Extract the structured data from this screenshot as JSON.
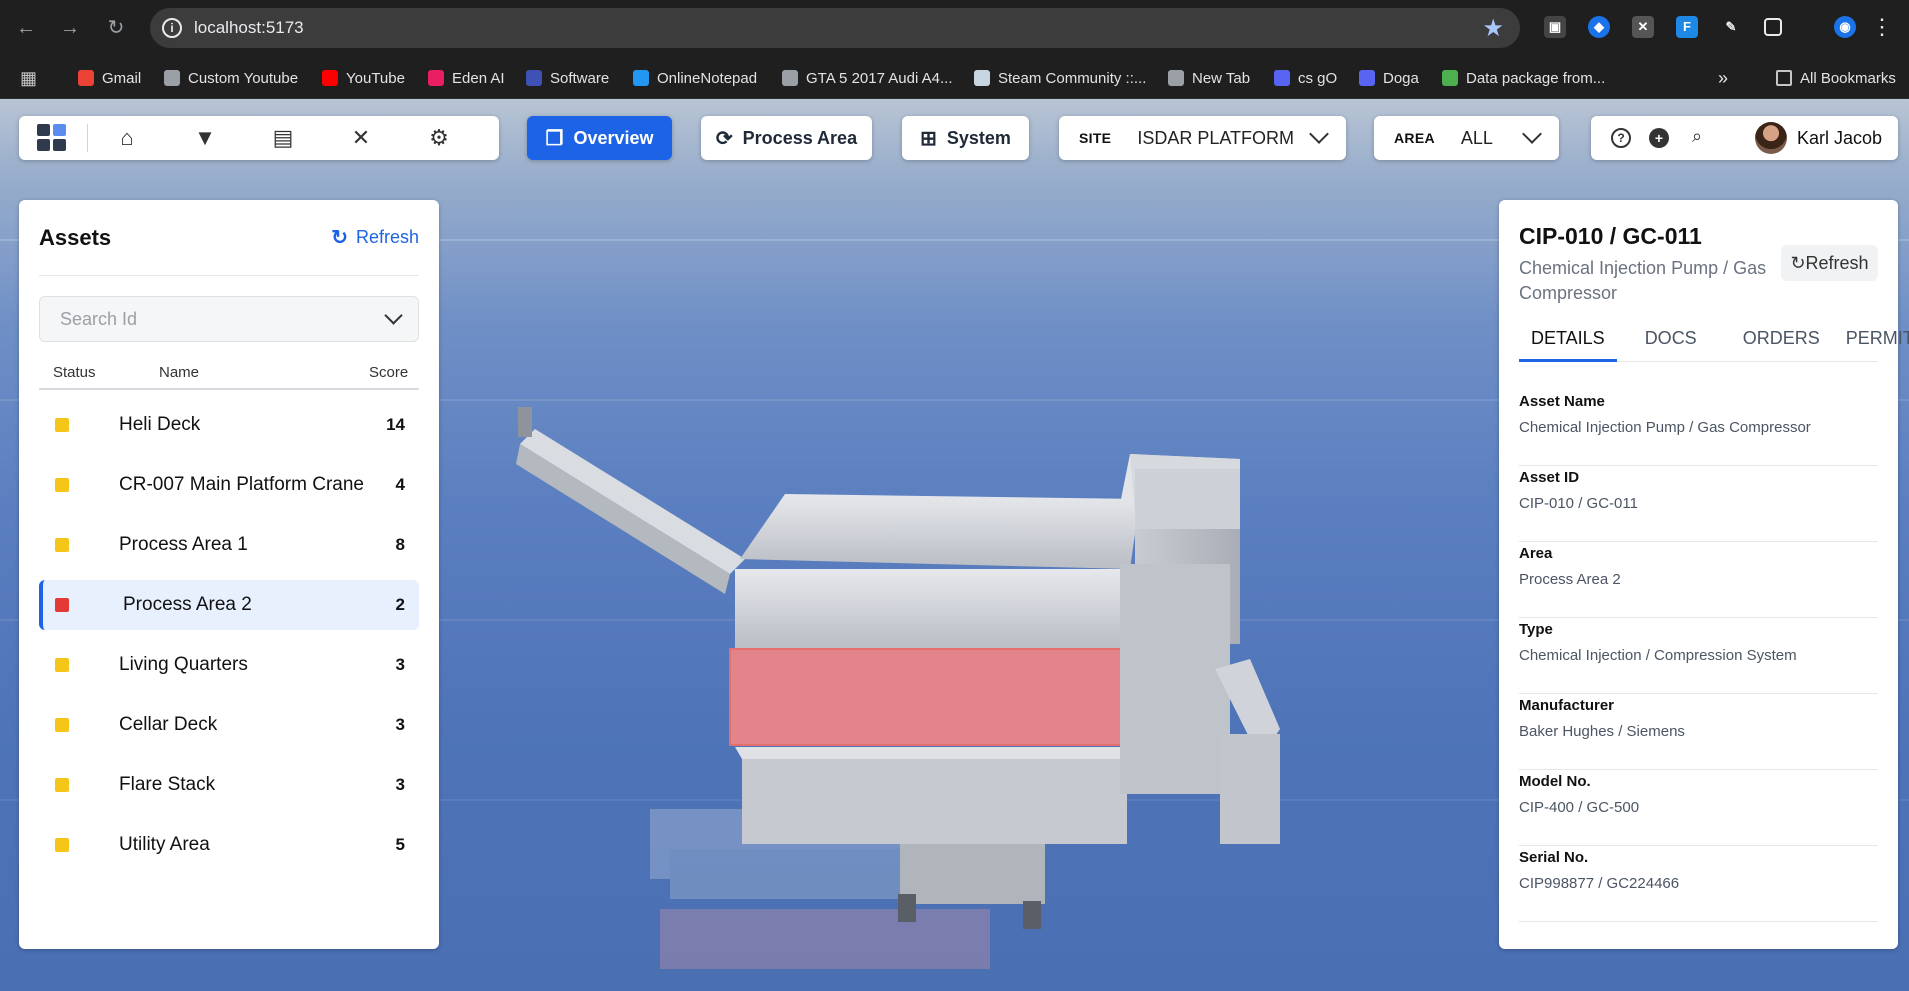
{
  "browser": {
    "url": "localhost:5173",
    "bookmarks": [
      {
        "label": "Gmail",
        "color": "#ea4335"
      },
      {
        "label": "Custom Youtube",
        "color": "#9aa0a6"
      },
      {
        "label": "YouTube",
        "color": "#ff0000"
      },
      {
        "label": "Eden AI",
        "color": "#e91e63"
      },
      {
        "label": "Software",
        "color": "#3f51b5"
      },
      {
        "label": "OnlineNotepad",
        "color": "#2196f3"
      },
      {
        "label": "GTA 5 2017 Audi A4...",
        "color": "#9aa0a6"
      },
      {
        "label": "Steam Community ::...",
        "color": "#c7d5e0"
      },
      {
        "label": "New Tab",
        "color": "#9aa0a6"
      },
      {
        "label": "cs gO",
        "color": "#5865f2"
      },
      {
        "label": "Doga",
        "color": "#5865f2"
      },
      {
        "label": "Data package from...",
        "color": "#4caf50"
      }
    ],
    "all_bookmarks_label": "All Bookmarks"
  },
  "toolbar": {
    "overview_label": "Overview",
    "process_area_label": "Process Area",
    "system_label": "System",
    "site_label": "SITE",
    "site_value": "ISDAR PLATFORM",
    "area_label": "AREA",
    "area_value": "ALL",
    "user_name": "Karl Jacob"
  },
  "assets": {
    "title": "Assets",
    "refresh_label": "Refresh",
    "search_placeholder": "Search Id",
    "columns": {
      "status": "Status",
      "name": "Name",
      "score": "Score"
    },
    "rows": [
      {
        "name": "Heli Deck",
        "score": "14",
        "status_color": "#f5c518"
      },
      {
        "name": "CR-007 Main Platform Crane",
        "score": "4",
        "status_color": "#f5c518"
      },
      {
        "name": "Process Area 1",
        "score": "8",
        "status_color": "#f5c518"
      },
      {
        "name": "Process Area 2",
        "score": "2",
        "status_color": "#e53935"
      },
      {
        "name": "Living Quarters",
        "score": "3",
        "status_color": "#f5c518"
      },
      {
        "name": "Cellar Deck",
        "score": "3",
        "status_color": "#f5c518"
      },
      {
        "name": "Flare Stack",
        "score": "3",
        "status_color": "#f5c518"
      },
      {
        "name": "Utility Area",
        "score": "5",
        "status_color": "#f5c518"
      }
    ]
  },
  "details": {
    "title": "CIP-010 / GC-011",
    "subtitle": "Chemical Injection Pump / Gas Compressor",
    "refresh_label": "Refresh",
    "tabs": [
      "DETAILS",
      "DOCS",
      "ORDERS",
      "PERMITS"
    ],
    "fields": [
      {
        "label": "Asset Name",
        "value": "Chemical Injection Pump / Gas Compressor"
      },
      {
        "label": "Asset ID",
        "value": "CIP-010 / GC-011"
      },
      {
        "label": "Area",
        "value": "Process Area 2"
      },
      {
        "label": "Type",
        "value": "Chemical Injection / Compression System"
      },
      {
        "label": "Manufacturer",
        "value": "Baker Hughes / Siemens"
      },
      {
        "label": "Model No.",
        "value": "CIP-400 / GC-500"
      },
      {
        "label": "Serial No.",
        "value": "CIP998877 / GC224466"
      }
    ]
  },
  "colors": {
    "accent": "#1d63e5",
    "highlight_red": "#f08080",
    "status_yellow": "#f5c518",
    "status_red": "#e53935"
  }
}
